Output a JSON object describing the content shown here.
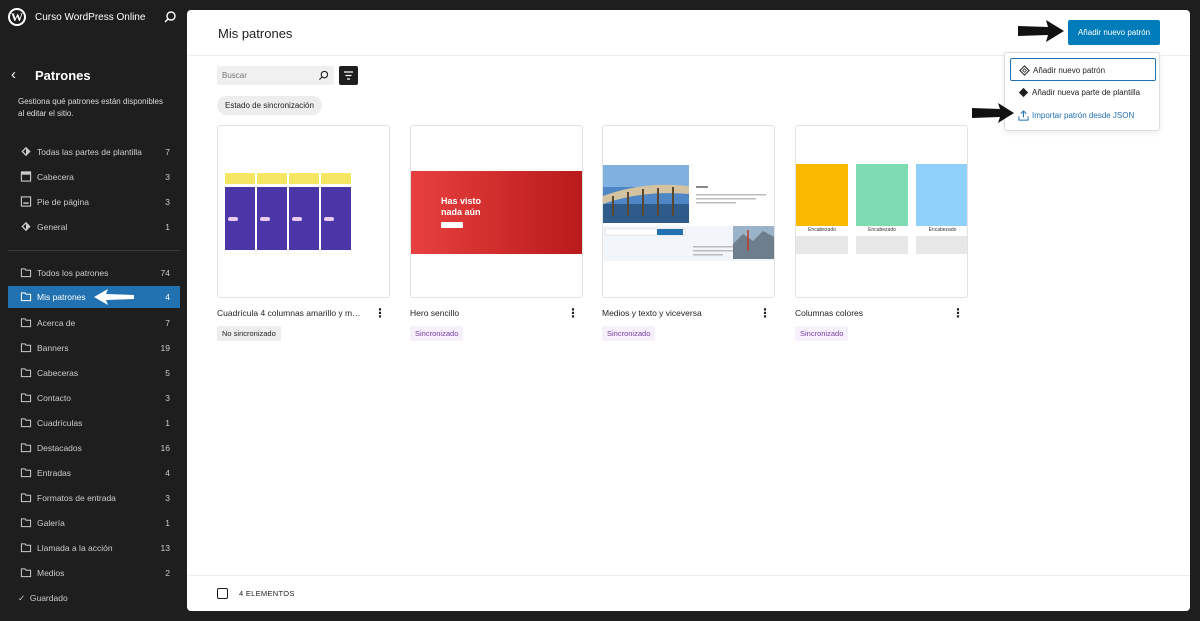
{
  "site": {
    "title": "Curso WordPress Online",
    "logo_letter": "W"
  },
  "sidebar": {
    "title": "Patrones",
    "description": "Gestiona qué patrones están disponibles al editar el sitio.",
    "template_parts": [
      {
        "label": "Todas las partes de plantilla",
        "count": "7",
        "icon": "diamond-icon"
      },
      {
        "label": "Cabecera",
        "count": "3",
        "icon": "header-layout-icon"
      },
      {
        "label": "Pie de página",
        "count": "3",
        "icon": "footer-layout-icon"
      },
      {
        "label": "General",
        "count": "1",
        "icon": "diamond-icon"
      }
    ],
    "categories": [
      {
        "label": "Todos los patrones",
        "count": "74"
      },
      {
        "label": "Mis patrones",
        "count": "4",
        "active": true
      },
      {
        "label": "Acerca de",
        "count": "7"
      },
      {
        "label": "Banners",
        "count": "19"
      },
      {
        "label": "Cabeceras",
        "count": "5"
      },
      {
        "label": "Contacto",
        "count": "3"
      },
      {
        "label": "Cuadrículas",
        "count": "1"
      },
      {
        "label": "Destacados",
        "count": "16"
      },
      {
        "label": "Entradas",
        "count": "4"
      },
      {
        "label": "Formatos de entrada",
        "count": "3"
      },
      {
        "label": "Galería",
        "count": "1"
      },
      {
        "label": "Llamada a la acción",
        "count": "13"
      },
      {
        "label": "Medios",
        "count": "2"
      }
    ],
    "status": "Guardado"
  },
  "main": {
    "title": "Mis patrones",
    "add_button": "Añadir nuevo patrón",
    "search_placeholder": "Buscar",
    "filter_chip": "Estado de sincronización",
    "cards": [
      {
        "title": "Cuadrícula 4 columnas amarillo y morado",
        "status": "No sincronizado",
        "synced": false
      },
      {
        "title": "Hero sencillo",
        "status": "Sincronizado",
        "synced": true,
        "hero_text": "Has visto nada aún"
      },
      {
        "title": "Medios y texto y viceversa",
        "status": "Sincronizado",
        "synced": true
      },
      {
        "title": "Columnas colores",
        "status": "Sincronizado",
        "synced": true,
        "column_caption": "Encabezado"
      }
    ],
    "footer_count": "4 ELEMENTOS"
  },
  "dropdown": {
    "items": [
      {
        "label": "Añadir nuevo patrón",
        "icon": "pattern-icon"
      },
      {
        "label": "Añadir nueva parte de plantilla",
        "icon": "template-part-icon"
      },
      {
        "label": "Importar patrón desde JSON",
        "icon": "upload-icon"
      }
    ]
  },
  "colors": {
    "accent": "#007cba",
    "sidebar_bg": "#1e1e1e",
    "active_item": "#2271b1",
    "synced_badge": "#7a3ea6"
  }
}
